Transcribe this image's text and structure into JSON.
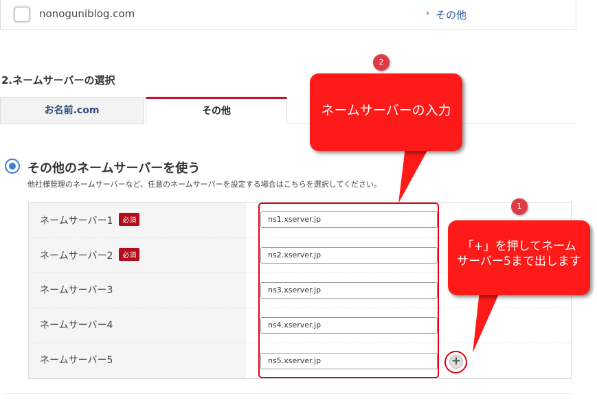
{
  "domain_row": {
    "domain": "nonoguniblog.com",
    "chevron": "›",
    "ns_type_link": "その他"
  },
  "section": {
    "title": "2.ネームサーバーの選択"
  },
  "tabs": [
    {
      "label": "お名前.com"
    },
    {
      "label": "その他"
    }
  ],
  "option": {
    "label": "その他のネームサーバーを使う",
    "description": "他社様管理のネームサーバーなど、任意のネームサーバーを設定する場合はこちらを選択してください。"
  },
  "required_badge": "必須",
  "nameservers": [
    {
      "label": "ネームサーバー1",
      "required": true,
      "value": "ns1.xserver.jp"
    },
    {
      "label": "ネームサーバー2",
      "required": true,
      "value": "ns2.xserver.jp"
    },
    {
      "label": "ネームサーバー3",
      "required": false,
      "value": "ns3.xserver.jp"
    },
    {
      "label": "ネームサーバー4",
      "required": false,
      "value": "ns4.xserver.jp"
    },
    {
      "label": "ネームサーバー5",
      "required": false,
      "value": "ns5.xserver.jp"
    }
  ],
  "plus_button": "+",
  "callouts": {
    "c2": {
      "number": "2",
      "text": "ネームサーバーの入力"
    },
    "c1": {
      "number": "1",
      "line1": "「+」を押してネーム",
      "line2": "サーバー5まで出します"
    }
  },
  "colors": {
    "accent_red": "#e00012",
    "callout_red": "#ff1a1a",
    "radio_blue": "#3a7fd5",
    "required_red": "#b30d1b"
  },
  "icons": {
    "checkbox": "checkbox-icon",
    "radio": "radio-selected-icon",
    "plus": "plus-icon",
    "chevron": "chevron-right-icon"
  }
}
